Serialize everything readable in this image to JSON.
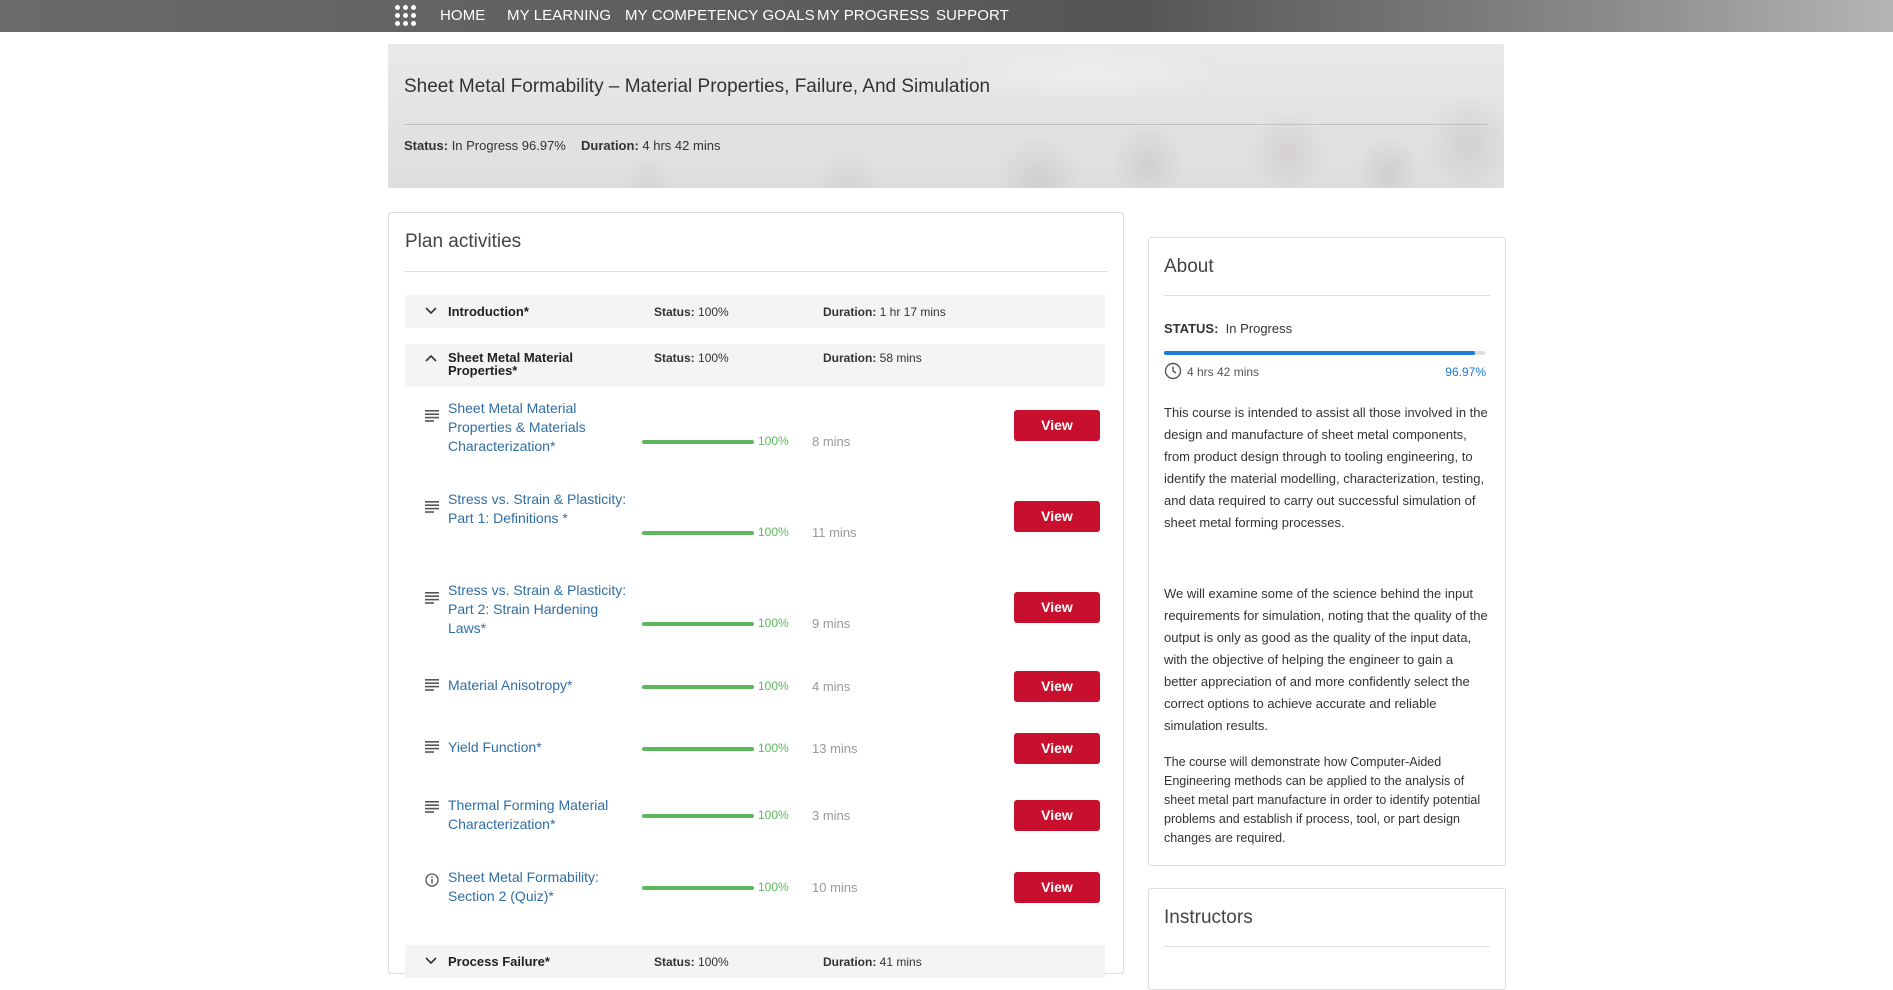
{
  "nav": {
    "items": [
      "HOME",
      "MY LEARNING",
      "MY COMPETENCY GOALS",
      "MY PROGRESS",
      "SUPPORT"
    ]
  },
  "hero": {
    "title": "Sheet Metal Formability – Material Properties, Failure, And Simulation",
    "status_label": "Status:",
    "status_value": "In Progress 96.97%",
    "duration_label": "Duration:",
    "duration_value": "4 hrs 42 mins"
  },
  "plan": {
    "title": "Plan activities",
    "status_label": "Status:",
    "duration_label": "Duration:",
    "view_label": "View",
    "sections": [
      {
        "name": "Introduction*",
        "status": "100%",
        "duration": "1 hr 17 mins",
        "expanded": false
      },
      {
        "name": "Sheet Metal Material Properties*",
        "status": "100%",
        "duration": "58 mins",
        "expanded": true
      },
      {
        "name": "Process Failure*",
        "status": "100%",
        "duration": "41 mins",
        "expanded": false
      }
    ],
    "activities": [
      {
        "title": "Sheet Metal Material Properties & Materials Characterization*",
        "progress": "100%",
        "duration": "8 mins",
        "icon": "document-icon"
      },
      {
        "title": "Stress vs. Strain & Plasticity: Part 1: Definitions *",
        "progress": "100%",
        "duration": "11 mins",
        "icon": "document-icon"
      },
      {
        "title": "Stress vs. Strain & Plasticity: Part 2: Strain Hardening Laws*",
        "progress": "100%",
        "duration": "9 mins",
        "icon": "document-icon"
      },
      {
        "title": "Material Anisotropy*",
        "progress": "100%",
        "duration": "4 mins",
        "icon": "document-icon"
      },
      {
        "title": "Yield Function*",
        "progress": "100%",
        "duration": "13 mins",
        "icon": "document-icon"
      },
      {
        "title": "Thermal Forming Material Characterization*",
        "progress": "100%",
        "duration": "3 mins",
        "icon": "document-icon"
      },
      {
        "title": "Sheet Metal Formability: Section 2 (Quiz)*",
        "progress": "100%",
        "duration": "10 mins",
        "icon": "info-icon"
      }
    ]
  },
  "about": {
    "title": "About",
    "status_label": "STATUS:",
    "status_value": "In Progress",
    "progress_fraction": 0.9697,
    "duration": "4 hrs 42 mins",
    "percent": "96.97%",
    "paragraphs": [
      "This course is intended to assist all those involved in the design and manufacture of sheet metal components, from product design through to tooling engineering, to identify the material modelling, characterization, testing, and data required to carry out successful simulation of sheet metal forming processes.",
      "We will examine some of the science behind the input requirements for simulation, noting that the quality of the output is only as good as the quality of the input data, with the objective of helping the engineer to gain a better appreciation of and more confidently select the correct options to achieve accurate and reliable simulation results.",
      "The course will demonstrate how Computer-Aided Engineering methods can be applied to the analysis of sheet metal part manufacture in order to identify potential problems and establish if process, tool, or part design changes are required."
    ]
  },
  "instructors": {
    "title": "Instructors"
  },
  "colors": {
    "accent_blue": "#1f7ad0",
    "link_blue": "#2f6ea5",
    "progress_green": "#5cb85c",
    "button_red": "#c8102e"
  }
}
